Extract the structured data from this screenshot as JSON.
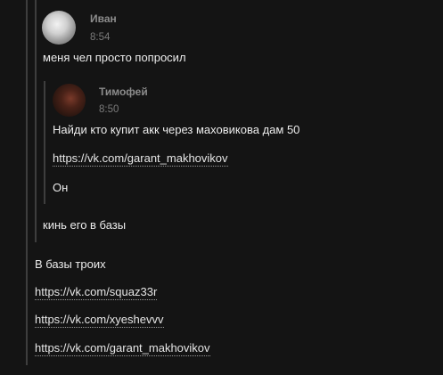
{
  "quoted_message": {
    "author": "Иван",
    "time": "8:54",
    "avatar_icon": "user-avatar",
    "text_before": "меня чел просто попросил",
    "nested_quote": {
      "author": "Тимофей",
      "time": "8:50",
      "avatar_icon": "user-avatar",
      "lines": [
        "Найди кто купит акк через маховикова дам 50",
        "https://vk.com/garant_makhovikov",
        "Он"
      ]
    },
    "text_after": "кинь его в базы"
  },
  "message": {
    "text": "В базы троих",
    "links": [
      "https://vk.com/squaz33r",
      "https://vk.com/xyeshevvv",
      "https://vk.com/garant_makhovikov"
    ]
  }
}
